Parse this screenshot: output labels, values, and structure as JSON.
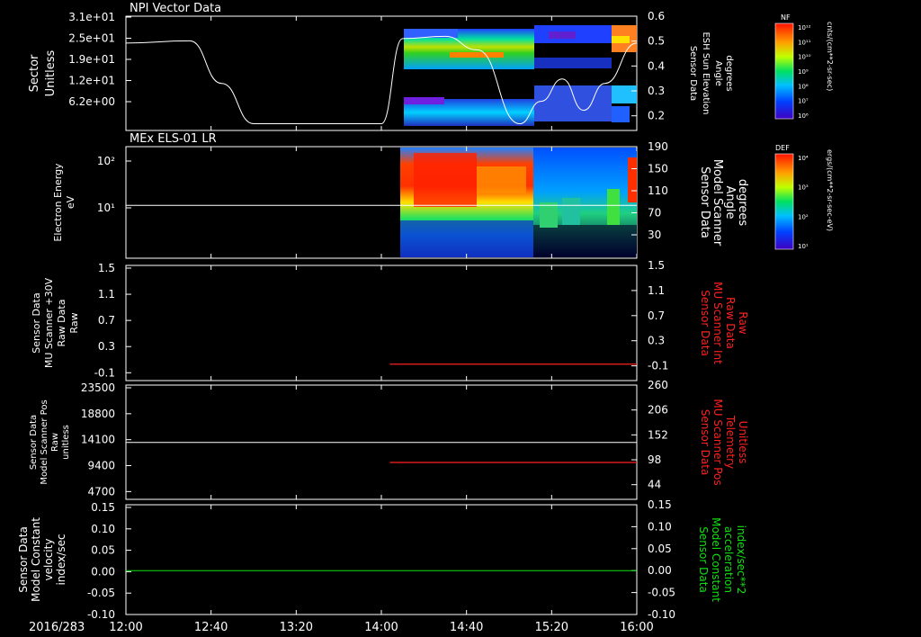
{
  "colors": {
    "background": "#000000",
    "axis": "#ffffff",
    "red_series": "#ff2020",
    "green_series": "#10e010"
  },
  "x_axis": {
    "date": "2016/283",
    "ticks": [
      "12:00",
      "12:40",
      "13:20",
      "14:00",
      "14:40",
      "15:20",
      "16:00"
    ]
  },
  "chart_data": [
    {
      "type": "heatmap",
      "title": "NPI Vector Data",
      "ylabel": [
        "Sector",
        "Unitless"
      ],
      "y_ticks": [
        "3.1e+01",
        "2.5e+01",
        "1.9e+01",
        "1.2e+01",
        "6.2e+00"
      ],
      "y2label": [
        "Sensor Data",
        "ESH Sun Elevation",
        "Angle",
        "degrees"
      ],
      "y2_ticks": [
        "0.6",
        "0.5",
        "0.4",
        "0.3",
        "0.2"
      ],
      "y2lim": [
        0.09,
        0.6
      ],
      "colorbar": {
        "label": "NF",
        "unit": "cnts/(cm**2-sr-sec)",
        "ticks": [
          "10¹²",
          "10¹¹",
          "10¹⁰",
          "10⁹",
          "10⁸",
          "10⁷",
          "10⁶"
        ]
      },
      "data_start": "14:06",
      "sun_elevation_line": {
        "x": [
          "12:00",
          "12:30",
          "12:45",
          "13:00",
          "13:40",
          "14:00",
          "14:10",
          "14:30",
          "14:45",
          "15:05",
          "15:15",
          "15:25",
          "15:35",
          "15:45",
          "16:00"
        ],
        "y": [
          0.48,
          0.49,
          0.3,
          0.12,
          0.12,
          0.12,
          0.5,
          0.51,
          0.45,
          0.12,
          0.22,
          0.32,
          0.18,
          0.3,
          0.48
        ]
      }
    },
    {
      "type": "heatmap",
      "title": "MEx ELS-01 LR",
      "ylabel": [
        "Electron Energy",
        "eV"
      ],
      "y_ticks": [
        "10²",
        "10¹"
      ],
      "y2label": [
        "Sensor Data",
        "Model Scanner",
        "Angle",
        "degrees"
      ],
      "y2_ticks": [
        "190",
        "150",
        "110",
        "70",
        "30"
      ],
      "y2lim": [
        0,
        190
      ],
      "colorbar": {
        "label": "DEF",
        "unit": "ergs/(cm**2-sr-sec-eV)",
        "ticks": [
          "10⁴",
          "10³",
          "10²",
          "10¹"
        ]
      },
      "data_start": "14:05",
      "scanner_angle_line": {
        "x": [
          "12:00",
          "16:00"
        ],
        "y": [
          90,
          90
        ]
      }
    },
    {
      "type": "line",
      "ylabel": [
        "Sensor Data",
        "MU Scanner +30V",
        "Raw Data",
        "Raw"
      ],
      "y_ticks": [
        "1.5",
        "1.1",
        "0.7",
        "0.3",
        "-0.1"
      ],
      "ylim": [
        -0.25,
        1.5
      ],
      "y2label": [
        "Sensor Data",
        "MU Scanner Int",
        "Raw Data",
        "Raw"
      ],
      "y2_ticks": [
        "1.5",
        "1.1",
        "0.7",
        "0.3",
        "-0.1"
      ],
      "series": [
        {
          "x": [
            "14:04",
            "16:00"
          ],
          "y": [
            0.0,
            0.0
          ]
        }
      ]
    },
    {
      "type": "line",
      "ylabel": [
        "Sensor Data",
        "Model Scanner Pos",
        "Raw",
        "unitless"
      ],
      "y_ticks": [
        "23500",
        "18800",
        "14100",
        "9400",
        "4700"
      ],
      "ylim": [
        0,
        23500
      ],
      "y2label": [
        "Sensor Data",
        "MU Scanner Pos",
        "Telemetry",
        "Unitless"
      ],
      "y2_ticks": [
        "260",
        "206",
        "152",
        "98",
        "44"
      ],
      "y2lim": [
        0,
        260
      ],
      "series": [
        {
          "x": [
            "12:00",
            "16:00"
          ],
          "y": [
            11700,
            11700
          ]
        },
        {
          "x": [
            "14:04",
            "16:00"
          ],
          "y2": [
            84,
            84
          ]
        }
      ]
    },
    {
      "type": "line",
      "ylabel": [
        "Sensor Data",
        "Model Constant",
        "velocity",
        "index/sec"
      ],
      "y_ticks": [
        "0.15",
        "0.10",
        "0.05",
        "0.00",
        "-0.05",
        "-0.10"
      ],
      "ylim": [
        -0.1,
        0.15
      ],
      "y2label": [
        "Sensor Data",
        "Model Constant",
        "acceleration",
        "index/sec**2"
      ],
      "y2_ticks": [
        "0.15",
        "0.10",
        "0.05",
        "0.00",
        "-0.05",
        "-0.10"
      ],
      "series": [
        {
          "x": [
            "12:00",
            "16:00"
          ],
          "y": [
            0.0,
            0.0
          ]
        }
      ]
    }
  ]
}
